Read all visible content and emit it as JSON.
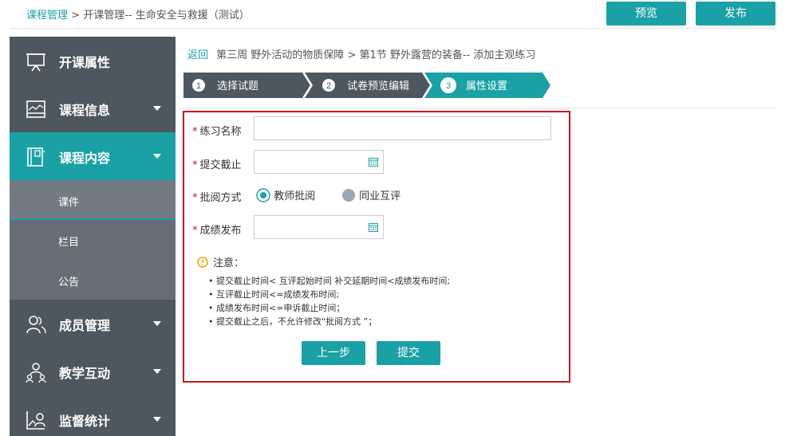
{
  "header": {
    "breadcrumb_link": "课程管理",
    "breadcrumb_sep": ">",
    "breadcrumb_rest": "开课管理-- 生命安全与救援（测试）",
    "preview_label": "预览",
    "publish_label": "发布"
  },
  "sidebar": {
    "items": [
      {
        "label": "开课属性",
        "icon": "presentation-icon"
      },
      {
        "label": "课程信息",
        "icon": "chart-board-icon"
      },
      {
        "label": "课程内容",
        "icon": "book-icon",
        "active": true
      },
      {
        "label": "成员管理",
        "icon": "users-icon"
      },
      {
        "label": "教学互动",
        "icon": "interaction-icon"
      },
      {
        "label": "监督统计",
        "icon": "statistics-icon"
      }
    ],
    "subitems": [
      {
        "label": "课件",
        "active": true
      },
      {
        "label": "栏目"
      },
      {
        "label": "公告"
      }
    ]
  },
  "path": {
    "back": "返回",
    "text": "第三周 野外活动的物质保障 > 第1节  野外露营的装备-- 添加主观练习"
  },
  "steps": [
    {
      "num": "1",
      "label": "选择试题"
    },
    {
      "num": "2",
      "label": "试卷预览编辑"
    },
    {
      "num": "3",
      "label": "属性设置",
      "active": true
    }
  ],
  "form": {
    "name_label": "练习名称",
    "name_value": "",
    "deadline_label": "提交截止",
    "deadline_value": "",
    "review_label": "批阅方式",
    "review_options": [
      "教师批阅",
      "同业互评"
    ],
    "review_selected": "教师批阅",
    "grade_label": "成绩发布",
    "grade_value": ""
  },
  "notes": {
    "title": "注意：",
    "lines": [
      "• 提交截止时间< 互评起始时间 补交延期时间<成绩发布时间;",
      "• 互评截止时间<=成绩发布时间;",
      "• 成绩发布时间<=申诉截止时间；",
      "• 提交截止之后，不允许修改\"批阅方式 ”；"
    ]
  },
  "buttons": {
    "prev": "上一步",
    "submit": "提交"
  },
  "colors": {
    "accent": "#1aa1a5",
    "sidebar": "#4d5760",
    "required": "#d0121b"
  }
}
